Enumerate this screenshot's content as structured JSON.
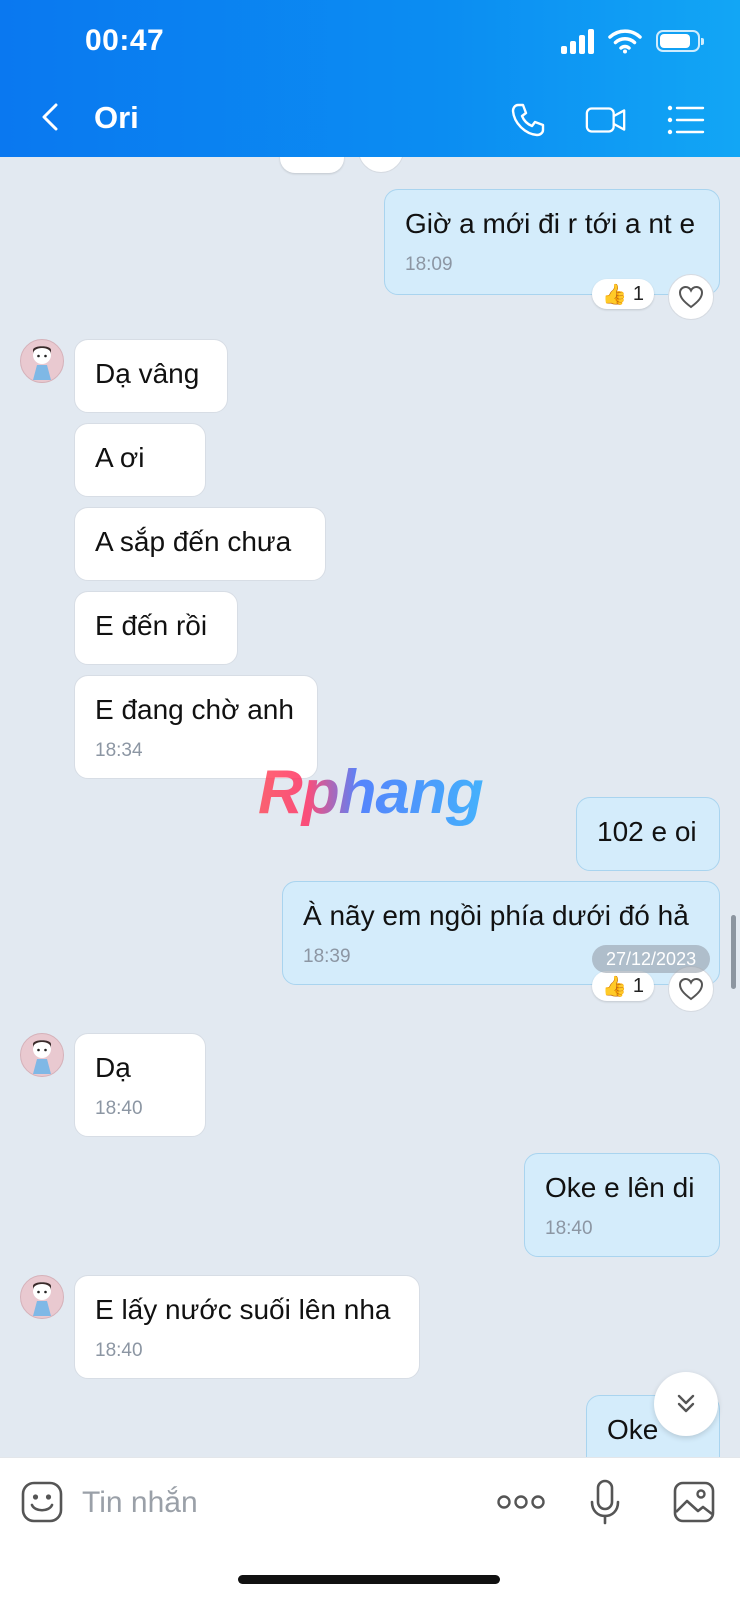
{
  "status_bar": {
    "time": "00:47"
  },
  "header": {
    "contact_name": "Ori"
  },
  "messages": [
    {
      "side": "out",
      "text": "Giờ a mới đi r tới a nt e",
      "time": "18:09",
      "reaction": {
        "emoji": "👍",
        "count": "1"
      }
    },
    {
      "side": "in",
      "text": "Dạ vâng"
    },
    {
      "side": "in",
      "text": "A ơi"
    },
    {
      "side": "in",
      "text": "A sắp đến chưa"
    },
    {
      "side": "in",
      "text": "E đến rồi"
    },
    {
      "side": "in",
      "text": "E đang chờ anh",
      "time": "18:34"
    },
    {
      "side": "out",
      "text": "102 e oi"
    },
    {
      "side": "out",
      "text": "À nãy em ngồi phía dưới đó hả",
      "time": "18:39",
      "reaction": {
        "emoji": "👍",
        "count": "1"
      }
    },
    {
      "side": "in",
      "text": "Dạ",
      "time": "18:40"
    },
    {
      "side": "out",
      "text": "Oke e lên di",
      "time": "18:40"
    },
    {
      "side": "in",
      "text": "E lấy nước suối lên nha",
      "time": "18:40"
    },
    {
      "side": "out",
      "text": "Oke"
    }
  ],
  "date_badge": "27/12/2023",
  "watermark": "Rphang",
  "composer": {
    "placeholder": "Tin nhắn"
  },
  "colors": {
    "header": "#0a78f0",
    "outgoing_bubble": "#d4ecfb",
    "incoming_bubble": "#ffffff",
    "chat_background": "#e2e9f1"
  },
  "icons": [
    "back-arrow-icon",
    "phone-icon",
    "video-call-icon",
    "menu-list-icon",
    "heart-icon",
    "chevron-double-down-icon",
    "emoji-icon",
    "more-dots-icon",
    "microphone-icon",
    "image-icon"
  ]
}
